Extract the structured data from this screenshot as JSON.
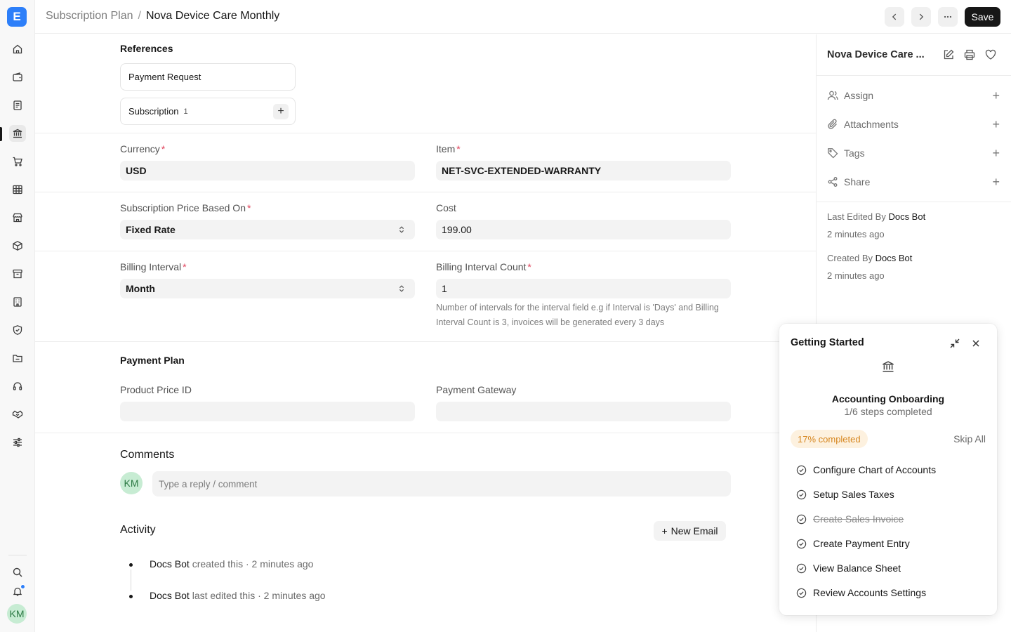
{
  "app": {
    "logo_letter": "E",
    "user_initials": "KM"
  },
  "rail": {
    "items": [
      {
        "icon": "home-icon"
      },
      {
        "icon": "wallet-icon"
      },
      {
        "icon": "document-icon"
      },
      {
        "icon": "bank-icon"
      },
      {
        "icon": "cart-icon"
      },
      {
        "icon": "table-icon"
      },
      {
        "icon": "store-icon"
      },
      {
        "icon": "box-icon"
      },
      {
        "icon": "archive-icon"
      },
      {
        "icon": "building-icon"
      },
      {
        "icon": "shield-icon"
      },
      {
        "icon": "folder-icon"
      },
      {
        "icon": "headset-icon"
      },
      {
        "icon": "handshake-icon"
      },
      {
        "icon": "sliders-icon"
      }
    ],
    "bottom": [
      {
        "icon": "search-icon"
      },
      {
        "icon": "bell-icon"
      }
    ]
  },
  "header": {
    "breadcrumb_parent": "Subscription Plan",
    "breadcrumb_sep": "/",
    "breadcrumb_current": "Nova Device Care Monthly",
    "save_label": "Save"
  },
  "references": {
    "title": "References",
    "items": [
      {
        "label": "Payment Request",
        "count": ""
      },
      {
        "label": "Subscription",
        "count": "1"
      }
    ]
  },
  "form": {
    "currency": {
      "label": "Currency",
      "required": "*",
      "value": "USD"
    },
    "item": {
      "label": "Item",
      "required": "*",
      "value": "NET-SVC-EXTENDED-WARRANTY"
    },
    "price_based_on": {
      "label": "Subscription Price Based On",
      "required": "*",
      "value": "Fixed Rate"
    },
    "cost": {
      "label": "Cost",
      "value": "199.00"
    },
    "billing_interval": {
      "label": "Billing Interval",
      "required": "*",
      "value": "Month"
    },
    "billing_interval_count": {
      "label": "Billing Interval Count",
      "required": "*",
      "value": "1",
      "help": "Number of intervals for the interval field e.g if Interval is 'Days' and Billing Interval Count is 3, invoices will be generated every 3 days"
    },
    "payment_plan_title": "Payment Plan",
    "product_price_id": {
      "label": "Product Price ID",
      "value": ""
    },
    "payment_gateway": {
      "label": "Payment Gateway",
      "value": ""
    }
  },
  "comments": {
    "title": "Comments",
    "avatar_initials": "KM",
    "placeholder": "Type a reply / comment"
  },
  "activity": {
    "title": "Activity",
    "new_email_label": "New Email",
    "entries": [
      {
        "who": "Docs Bot",
        "text": " created this · 2 minutes ago"
      },
      {
        "who": "Docs Bot",
        "text": " last edited this · 2 minutes ago"
      }
    ]
  },
  "sidebar": {
    "title": "Nova Device Care ...",
    "rows": [
      {
        "label": "Assign",
        "icon": "user-icon"
      },
      {
        "label": "Attachments",
        "icon": "paperclip-icon"
      },
      {
        "label": "Tags",
        "icon": "tag-icon"
      },
      {
        "label": "Share",
        "icon": "share-icon"
      }
    ],
    "last_edited_label": "Last Edited By ",
    "last_edited_by": "Docs Bot",
    "last_edited_time": "2 minutes ago",
    "created_label": "Created By ",
    "created_by": "Docs Bot",
    "created_time": "2 minutes ago"
  },
  "getting_started": {
    "title": "Getting Started",
    "heading": "Accounting Onboarding",
    "subheading": "1/6 steps completed",
    "progress_percent": 17,
    "progress_label": "17% completed",
    "skip_label": "Skip All",
    "steps": [
      {
        "label": "Configure Chart of Accounts",
        "done": false
      },
      {
        "label": "Setup Sales Taxes",
        "done": false
      },
      {
        "label": "Create Sales Invoice",
        "done": true
      },
      {
        "label": "Create Payment Entry",
        "done": false
      },
      {
        "label": "View Balance Sheet",
        "done": false
      },
      {
        "label": "Review Accounts Settings",
        "done": false
      }
    ]
  },
  "colors": {
    "accent": "#2d7ff9",
    "primary_button": "#171717",
    "required": "#e0445c",
    "badge_bg": "#fdf1df",
    "badge_text": "#d6861f"
  }
}
